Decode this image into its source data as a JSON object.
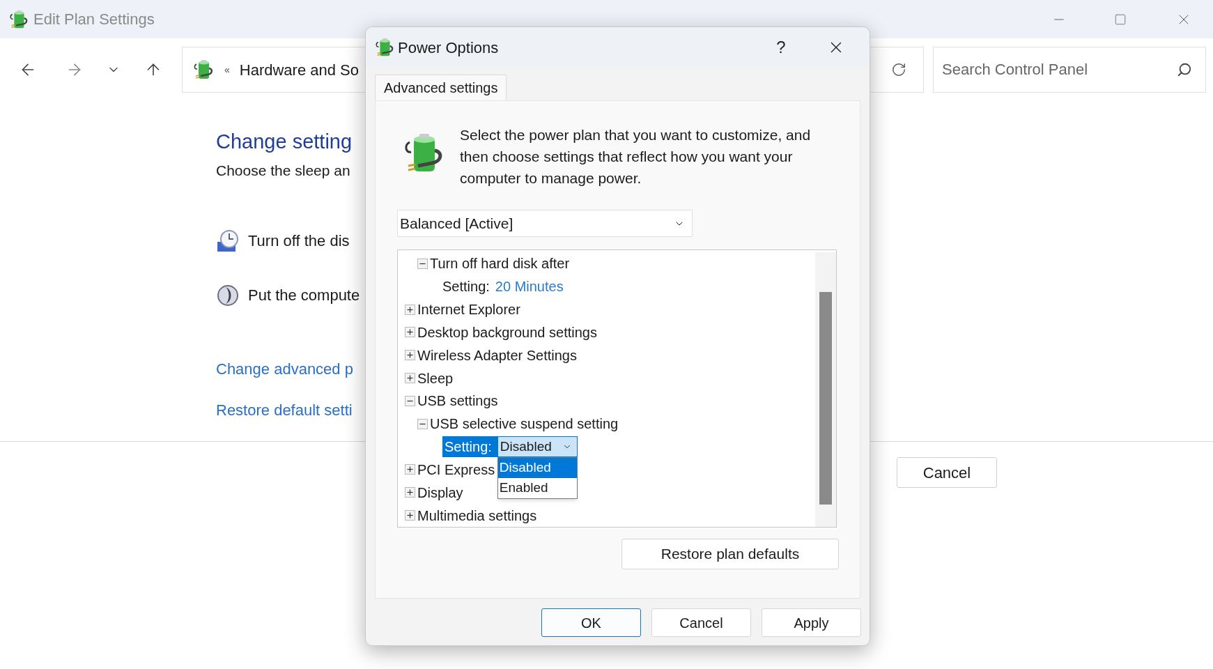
{
  "window": {
    "title": "Edit Plan Settings"
  },
  "address_bar": {
    "separator": "«",
    "path": "Hardware and So"
  },
  "search": {
    "placeholder": "Search Control Panel"
  },
  "content": {
    "heading": "Change setting",
    "subtitle": "Choose the sleep an",
    "settings": [
      {
        "kind": "clock",
        "label": "Turn off the dis"
      },
      {
        "kind": "moon",
        "label": "Put the compute"
      }
    ],
    "links": [
      "Change advanced p",
      "Restore default setti"
    ]
  },
  "footer": {
    "cancel": "Cancel"
  },
  "dialog": {
    "title": "Power Options",
    "help": "?",
    "tabs": [
      {
        "label": "Advanced settings",
        "selected": true
      }
    ],
    "description": "Select the power plan that you want to customize, and then choose settings that reflect how you want your computer to manage power.",
    "plan_select": {
      "value": "Balanced [Active]"
    },
    "tree": {
      "items": [
        {
          "kind": "continued",
          "children": [
            {
              "kind": "group",
              "label": "Turn off hard disk after",
              "expanded": true,
              "children": [
                {
                  "kind": "setting",
                  "label": "Setting:",
                  "value": "20 Minutes"
                }
              ]
            }
          ]
        },
        {
          "kind": "group",
          "label": "Internet Explorer",
          "expanded": false
        },
        {
          "kind": "group",
          "label": "Desktop background settings",
          "expanded": false
        },
        {
          "kind": "group",
          "label": "Wireless Adapter Settings",
          "expanded": false
        },
        {
          "kind": "group",
          "label": "Sleep",
          "expanded": false
        },
        {
          "kind": "group",
          "label": "USB settings",
          "expanded": true,
          "children": [
            {
              "kind": "group",
              "label": "USB selective suspend setting",
              "expanded": true,
              "children": [
                {
                  "kind": "dropdown",
                  "label": "Setting:",
                  "value": "Disabled",
                  "selected": true,
                  "options": [
                    {
                      "label": "Disabled",
                      "selected": true
                    },
                    {
                      "label": "Enabled",
                      "selected": false
                    }
                  ]
                }
              ]
            }
          ]
        },
        {
          "kind": "group",
          "label": "PCI Express",
          "expanded": false
        },
        {
          "kind": "group",
          "label": "Display",
          "expanded": false
        },
        {
          "kind": "group",
          "label": "Multimedia settings",
          "expanded": false
        }
      ]
    },
    "restore_button": "Restore plan defaults",
    "buttons": [
      {
        "label": "OK",
        "kind": "default"
      },
      {
        "label": "Cancel",
        "kind": "normal"
      },
      {
        "label": "Apply",
        "kind": "normal"
      }
    ]
  }
}
